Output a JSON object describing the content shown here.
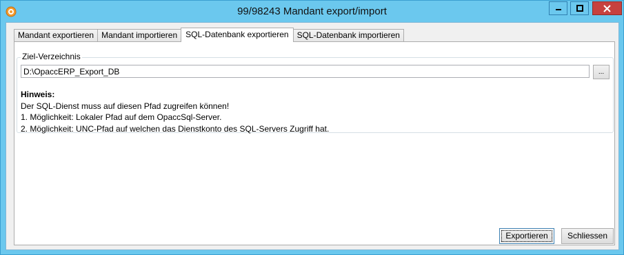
{
  "window": {
    "title": "99/98243 Mandant export/import",
    "icon": "orange-target-app-icon",
    "caption_buttons": {
      "minimize": "minimize-icon",
      "maximize": "maximize-icon",
      "close": "close-icon"
    },
    "colors": {
      "frame": "#6bc8ee",
      "close_button": "#c7413e",
      "client_bg": "#f0f0f0"
    }
  },
  "tabs": [
    {
      "label": "Mandant exportieren",
      "active": false
    },
    {
      "label": "Mandant importieren",
      "active": false
    },
    {
      "label": "SQL-Datenbank exportieren",
      "active": true
    },
    {
      "label": "SQL-Datenbank importieren",
      "active": false
    }
  ],
  "target": {
    "group_label": "Ziel-Verzeichnis",
    "path_value": "D:\\OpaccERP_Export_DB",
    "browse_label": "..."
  },
  "note": {
    "heading": "Hinweis:",
    "lines": [
      "Der SQL-Dienst muss auf diesen Pfad zugreifen können!",
      "1. Möglichkeit: Lokaler Pfad auf dem OpaccSql-Server.",
      "2. Möglichkeit: UNC-Pfad auf welchen das Dienstkonto des SQL-Servers Zugriff hat."
    ]
  },
  "buttons": {
    "export_label": "Exportieren",
    "close_label": "Schliessen"
  }
}
